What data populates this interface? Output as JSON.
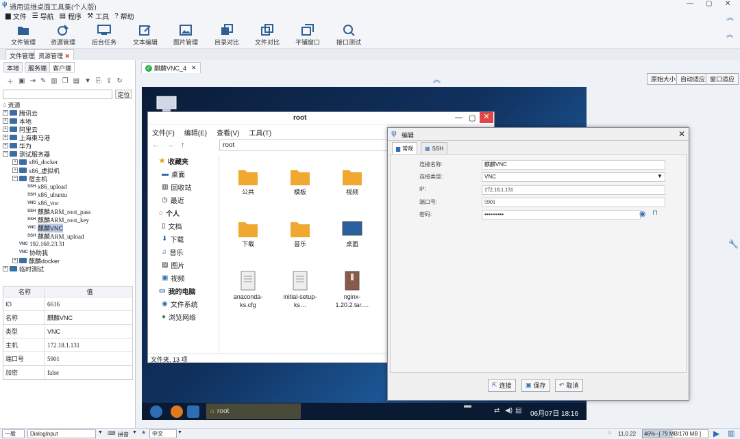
{
  "app": {
    "title": "通用运维桌面工具集(个人版)"
  },
  "menu": [
    "文件",
    "导航",
    "程序",
    "工具",
    "帮助"
  ],
  "toolbar": [
    "文件管理",
    "资源管理",
    "后台任务",
    "文本编辑",
    "图片管理",
    "目录对比",
    "文件对比",
    "平铺窗口",
    "接口测试"
  ],
  "module_tabs": [
    "文件管理",
    "资源管理"
  ],
  "side_tabs": [
    "本地",
    "服务端",
    "客户端"
  ],
  "locate_button": "定位",
  "tree": {
    "root": "资源",
    "items": [
      "腾讯云",
      "本地",
      "阿里云",
      "上海東马港",
      "华为",
      "测试服务器",
      "x86_docker",
      "x86_虚拟机",
      "宿主机",
      "x86_upload",
      "x86_ubuntu",
      "x86_vnc",
      "麒麟ARM_root_pass",
      "麒麟ARM_root_key",
      "麒麟VNC",
      "麒麟ARM_upload",
      "192.168.23.31",
      "协助我",
      "麒麟docker",
      "临时测试"
    ],
    "badges": {
      "ssh": "SSH",
      "vnc": "VNC"
    }
  },
  "props": {
    "header": [
      "名称",
      "值"
    ],
    "rows": [
      [
        "ID",
        "6616"
      ],
      [
        "名称",
        "麒麟VNC"
      ],
      [
        "类型",
        "VNC"
      ],
      [
        "主机",
        "172.18.1.131"
      ],
      [
        "端口号",
        "5901"
      ],
      [
        "加密",
        "false"
      ]
    ]
  },
  "session_tab": "麒麟VNC_4",
  "view_buttons": [
    "原始大小",
    "自动适应",
    "窗口适应"
  ],
  "filemanager": {
    "title": "root",
    "menus": [
      "文件(F)",
      "编辑(E)",
      "查看(V)",
      "工具(T)"
    ],
    "path": "root",
    "sidebar": [
      "收藏夹",
      "桌面",
      "回收站",
      "最近",
      "个人",
      "文档",
      "下载",
      "音乐",
      "图片",
      "视频",
      "我的电脑",
      "文件系统",
      "浏览网络"
    ],
    "files": [
      "公共",
      "模板",
      "视频",
      "下载",
      "音乐",
      "桌面",
      "anaconda-ks.cfg",
      "initial-setup-ks…",
      "nginx-1.20.2.tar.…"
    ],
    "status": "文件夹, 13 项"
  },
  "dialog": {
    "title": "编辑",
    "tabs": [
      "常规",
      "SSH"
    ],
    "fields": [
      {
        "label": "连接名称:",
        "value": "麒麟VNC"
      },
      {
        "label": "连接类型:",
        "value": "VNC"
      },
      {
        "label": "IP:",
        "value": "172.18.1.131"
      },
      {
        "label": "端口号:",
        "value": "5901"
      },
      {
        "label": "密码:",
        "value": "••••••••••"
      }
    ],
    "buttons": [
      "连接",
      "保存",
      "取消"
    ]
  },
  "taskbar": {
    "window": "root",
    "clock": "06月07日 18:16"
  },
  "status": {
    "level": "一般",
    "input": "DialogInput",
    "lang1": "拼音",
    "lang2": "中文",
    "version": "11.0.22",
    "mem": "46%--[ 79 MB/170 MB ]"
  },
  "colors": {
    "accent": "#2f6db5",
    "desktop": "#10315e",
    "ok": "#2db24a"
  }
}
